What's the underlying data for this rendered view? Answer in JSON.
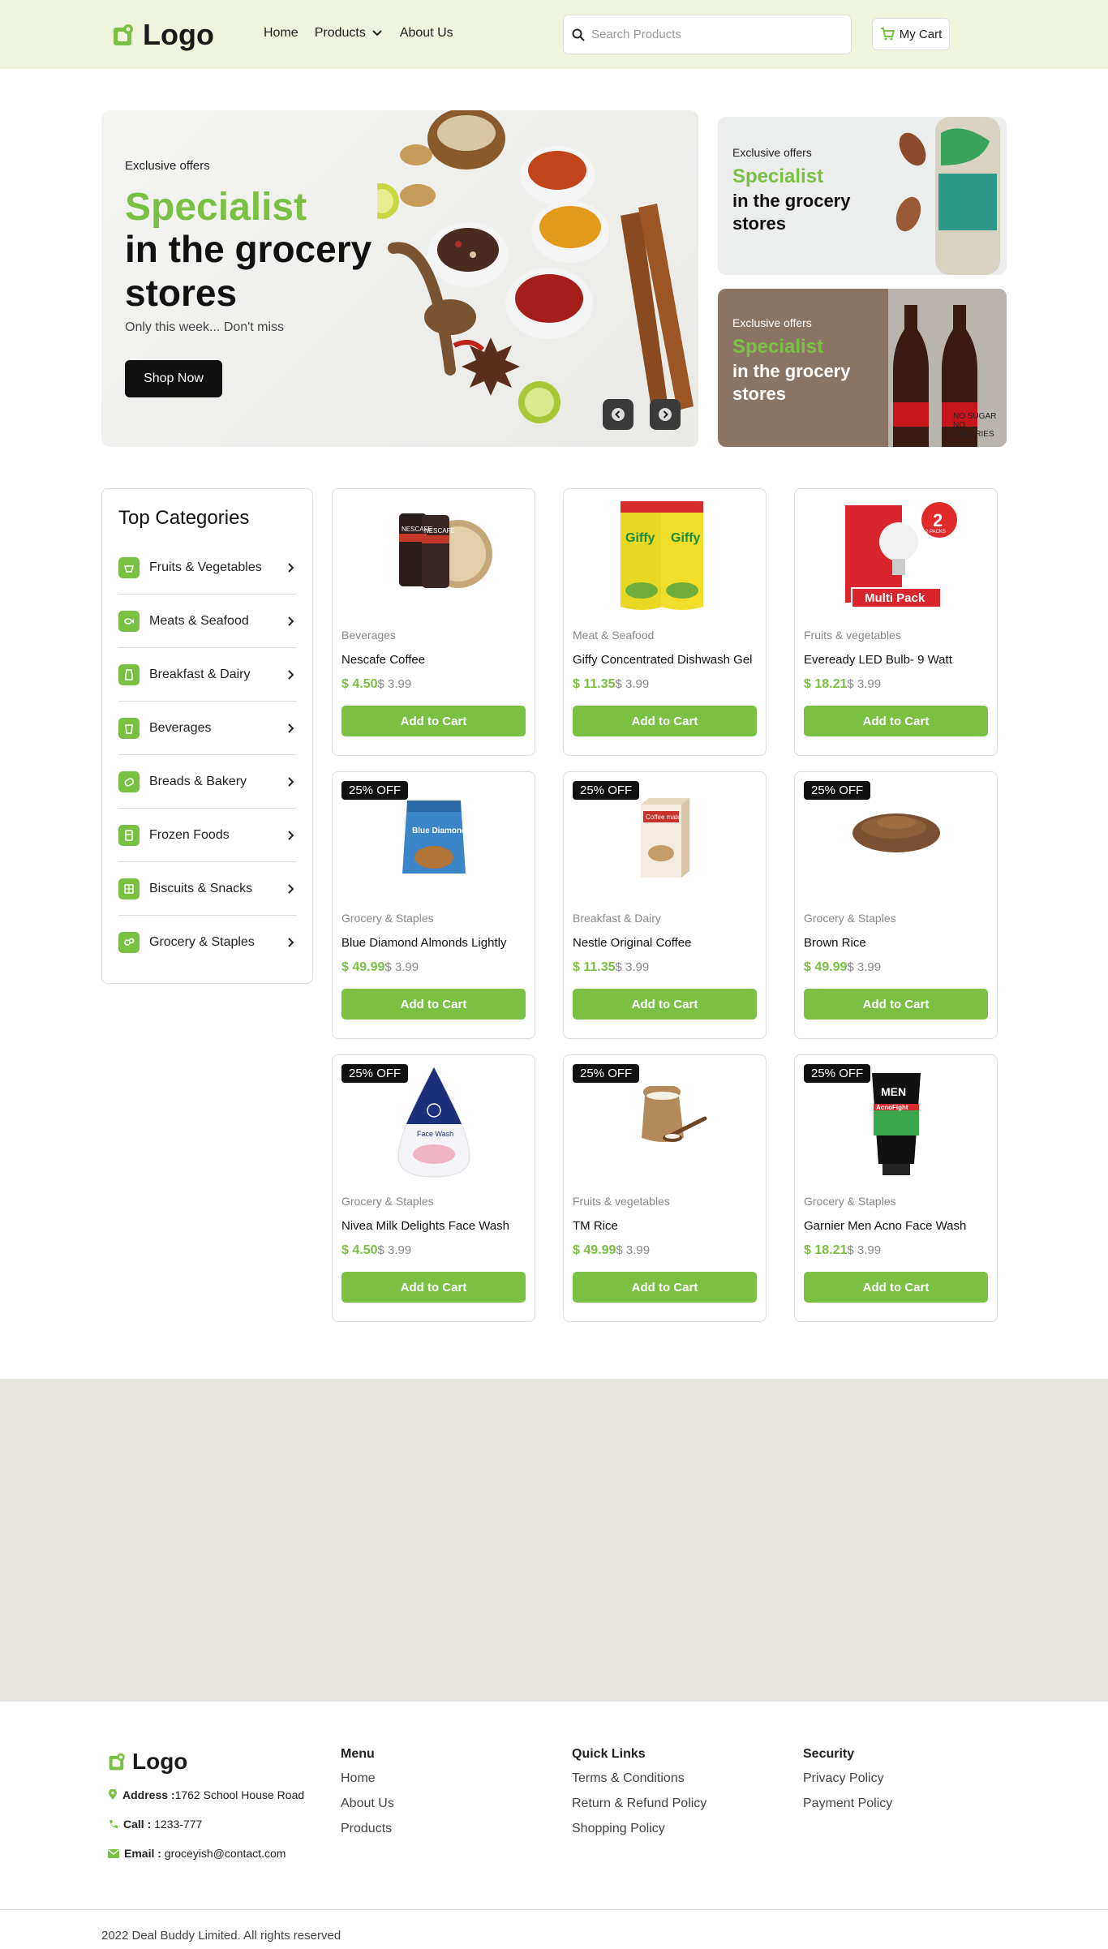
{
  "header": {
    "logo_text": "Logo",
    "nav": [
      {
        "label": "Home"
      },
      {
        "label": "Products"
      },
      {
        "label": "About Us"
      }
    ],
    "search_placeholder": "Search Products",
    "cart_label": "My Cart"
  },
  "hero": {
    "eyebrow": "Exclusive offers",
    "title_green": "Specialist",
    "title_dark": "in the grocery stores",
    "subtitle": "Only this week... Don't miss",
    "cta": "Shop Now"
  },
  "promos": [
    {
      "eyebrow": "Exclusive offers",
      "title_green": "Specialist",
      "title_dark": "in the grocery stores"
    },
    {
      "eyebrow": "Exclusive offers",
      "title_green": "Specialist",
      "title_dark": "in the grocery stores",
      "bottle_text": "NO SUGAR NO CALORIES"
    }
  ],
  "sidebar": {
    "title": "Top Categories",
    "items": [
      {
        "label": "Fruits & Vegetables"
      },
      {
        "label": "Meats & Seafood"
      },
      {
        "label": "Breakfast & Dairy"
      },
      {
        "label": "Beverages"
      },
      {
        "label": "Breads & Bakery"
      },
      {
        "label": "Frozen Foods"
      },
      {
        "label": "Biscuits & Snacks"
      },
      {
        "label": "Grocery & Staples"
      }
    ]
  },
  "products": [
    {
      "category": "Beverages",
      "name": "Nescafe Coffee",
      "price": "$ 4.50",
      "old_price": "$ 3.99",
      "badge": "",
      "cta": "Add to Cart",
      "image_text": "NESCAFE"
    },
    {
      "category": "Meat & Seafood",
      "name": "Giffy Concentrated Dishwash Gel",
      "price": "$ 11.35",
      "old_price": "$ 3.99",
      "badge": "",
      "cta": "Add to Cart",
      "image_text": "Giffy"
    },
    {
      "category": "Fruits & vegetables",
      "name": "Eveready LED Bulb- 9 Watt",
      "price": "$ 18.21",
      "old_price": "$ 3.99",
      "badge": "",
      "cta": "Add to Cart",
      "image_text": "Multi Pack",
      "image_sub": "2 PACKS"
    },
    {
      "category": "Grocery & Staples",
      "name": "Blue Diamond Almonds Lightly",
      "price": "$ 49.99",
      "old_price": "$ 3.99",
      "badge": "25% OFF",
      "cta": "Add to Cart",
      "image_text": "Blue Diamond"
    },
    {
      "category": "Breakfast & Dairy",
      "name": "Nestle Original Coffee",
      "price": "$ 11.35",
      "old_price": "$ 3.99",
      "badge": "25% OFF",
      "cta": "Add to Cart",
      "image_text": "Coffee mate"
    },
    {
      "category": "Grocery & Staples",
      "name": "Brown Rice",
      "price": "$ 49.99",
      "old_price": "$ 3.99",
      "badge": "25% OFF",
      "cta": "Add to Cart",
      "image_text": ""
    },
    {
      "category": "Grocery & Staples",
      "name": "Nivea Milk Delights Face Wash",
      "price": "$ 4.50",
      "old_price": "$ 3.99",
      "badge": "25% OFF",
      "cta": "Add to Cart",
      "image_text": "Face Wash"
    },
    {
      "category": "Fruits & vegetables",
      "name": "TM Rice",
      "price": "$ 49.99",
      "old_price": "$ 3.99",
      "badge": "25% OFF",
      "cta": "Add to Cart",
      "image_text": ""
    },
    {
      "category": "Grocery & Staples",
      "name": "Garnier Men Acno Face Wash",
      "price": "$ 18.21",
      "old_price": "$ 3.99",
      "badge": "25% OFF",
      "cta": "Add to Cart",
      "image_text": "AcnoFight"
    }
  ],
  "footer": {
    "logo_text": "Logo",
    "address_label": "Address :",
    "address_value": "1762 School House Road",
    "call_label": "Call :",
    "call_value": "1233-777",
    "email_label": "Email :",
    "email_value": "groceyish@contact.com",
    "columns": [
      {
        "title": "Menu",
        "links": [
          "Home",
          "About Us",
          "Products"
        ]
      },
      {
        "title": "Quick Links",
        "links": [
          "Terms & Conditions",
          "Return & Refund Policy",
          "Shopping Policy"
        ]
      },
      {
        "title": "Security",
        "links": [
          "Privacy Policy",
          "Payment Policy"
        ]
      }
    ],
    "copyright": "2022 Deal Buddy Limited. All rights reserved"
  },
  "colors": {
    "accent": "#7ac143",
    "header_bg": "#eef4dd",
    "band_bg": "#e6e5e0",
    "dark": "#111111"
  }
}
